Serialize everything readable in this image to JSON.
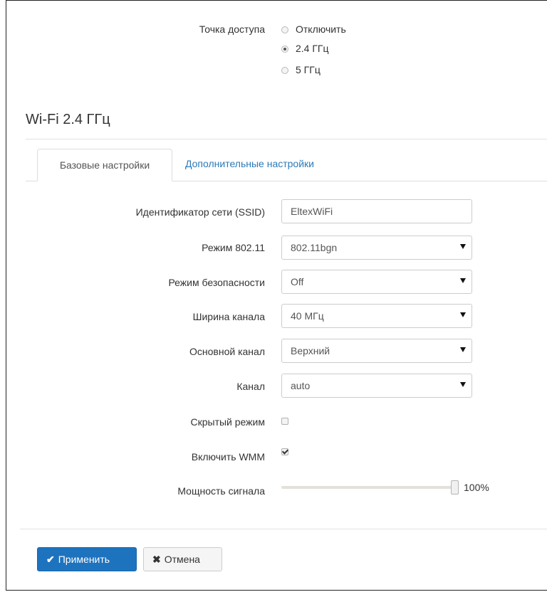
{
  "access_point": {
    "label": "Точка доступа",
    "options": [
      {
        "label": "Отключить",
        "checked": false
      },
      {
        "label": "2.4 ГГц",
        "checked": true
      },
      {
        "label": "5 ГГц",
        "checked": false
      }
    ]
  },
  "section": {
    "title": "Wi-Fi 2.4 ГГц"
  },
  "tabs": [
    {
      "label": "Базовые настройки",
      "active": true
    },
    {
      "label": "Дополнительные настройки",
      "active": false
    }
  ],
  "form": {
    "ssid": {
      "label": "Идентификатор сети (SSID)",
      "value": "EltexWiFi"
    },
    "mode": {
      "label": "Режим 802.11",
      "value": "802.11bgn"
    },
    "security": {
      "label": "Режим безопасности",
      "value": "Off"
    },
    "width": {
      "label": "Ширина канала",
      "value": "40 МГц"
    },
    "primary": {
      "label": "Основной канал",
      "value": "Верхний"
    },
    "channel": {
      "label": "Канал",
      "value": "auto"
    },
    "hidden": {
      "label": "Скрытый режим",
      "checked": false
    },
    "wmm": {
      "label": "Включить WMM",
      "checked": true
    },
    "power": {
      "label": "Мощность сигнала",
      "value_text": "100%",
      "value": 100
    }
  },
  "buttons": {
    "apply": {
      "label": "Применить",
      "icon": "check-icon"
    },
    "cancel": {
      "label": "Отмена",
      "icon": "close-icon"
    }
  },
  "colors": {
    "primary": "#1e73be",
    "link": "#2a7ab8"
  }
}
